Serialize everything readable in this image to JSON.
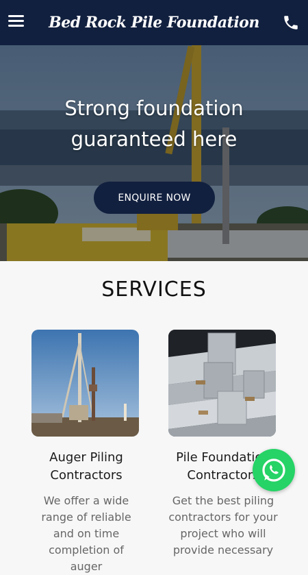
{
  "header": {
    "brand": "Bed Rock Pile Foundation",
    "menu_icon": "hamburger-menu-icon",
    "phone_icon": "phone-icon",
    "background_color": "#12203f"
  },
  "hero": {
    "title_line1": "Strong foundation",
    "title_line2": "guaranteed here",
    "cta_label": "ENQUIRE NOW"
  },
  "services": {
    "heading": "SERVICES",
    "items": [
      {
        "title": "Auger Piling\nContractors",
        "description": "We offer a wide\nrange of reliable\nand on time\ncompletion of auger"
      },
      {
        "title": "Pile Foundation\nContractors",
        "description": "Get the best piling\ncontractors for your\nproject who will\nprovide necessary"
      }
    ]
  },
  "floating": {
    "whatsapp_icon": "whatsapp-icon",
    "whatsapp_color": "#25d366"
  }
}
